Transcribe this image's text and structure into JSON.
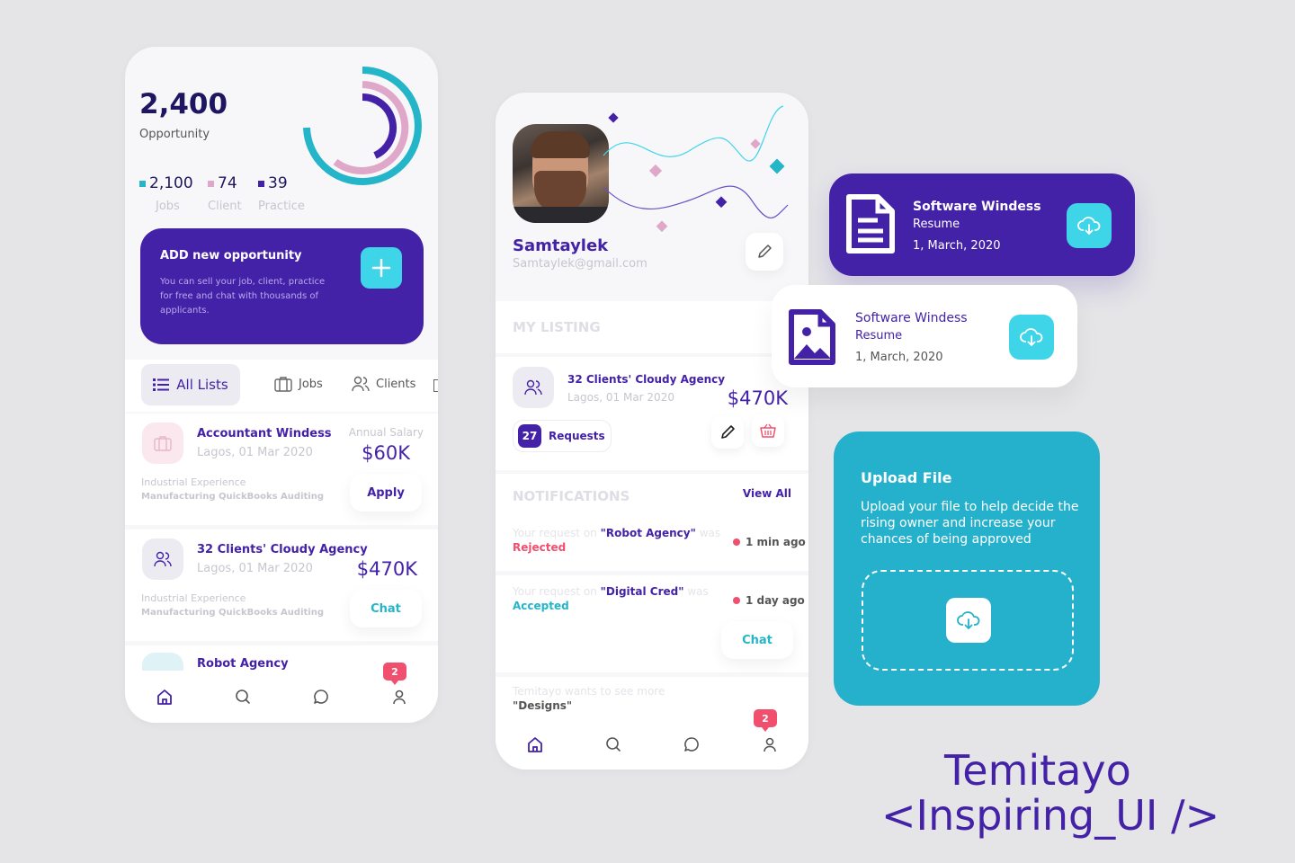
{
  "left_phone": {
    "total_value": "2,400",
    "total_label": "Opportunity",
    "stats": [
      {
        "value": "2,100",
        "label": "Jobs",
        "color": "#25b5c9"
      },
      {
        "value": "74",
        "label": "Client",
        "color": "#e0a8c8"
      },
      {
        "value": "39",
        "label": "Practice",
        "color": "#4422a8"
      }
    ],
    "add_card": {
      "title": "ADD new opportunity",
      "description": "You can sell your job, client, practice for free and chat with thousands of applicants."
    },
    "tabs": [
      "All Lists",
      "Jobs",
      "Clients"
    ],
    "listings": [
      {
        "title": "Accountant Windess",
        "subtitle": "Lagos, 01 Mar 2020",
        "price_label": "Annual Salary",
        "price": "$60K",
        "meta_label": "Industrial Experience",
        "meta_value": "Manufacturing QuickBooks Auditing",
        "action": "Apply"
      },
      {
        "title": "32 Clients' Cloudy Agency",
        "subtitle": "Lagos, 01 Mar 2020",
        "price_label": "",
        "price": "$470K",
        "meta_label": "Industrial Experience",
        "meta_value": "Manufacturing QuickBooks Auditing",
        "action": "Chat"
      },
      {
        "title": "Robot Agency"
      }
    ],
    "nav_badge": "2"
  },
  "middle_phone": {
    "name": "Samtaylek",
    "email": "Samtaylek@gmail.com",
    "listing_header": "MY LISTING",
    "listing": {
      "title": "32 Clients' Cloudy Agency",
      "subtitle": "Lagos, 01 Mar 2020",
      "price": "$470K",
      "requests_count": "27",
      "requests_label": "Requests"
    },
    "notifications_header": "NOTIFICATIONS",
    "view_all": "View All",
    "notifications": [
      {
        "prefix": "Your request on",
        "name": "\"Robot Agency\"",
        "suffix": "was",
        "status": "Rejected",
        "time": "1 min ago"
      },
      {
        "prefix": "Your request on",
        "name": "\"Digital Cred\"",
        "suffix": "was",
        "status": "Accepted",
        "time": "1 day ago",
        "action": "Chat"
      },
      {
        "prefix": "Temitayo wants to see more",
        "name": "\"Designs\""
      }
    ],
    "nav_badge": "2"
  },
  "resume_cards": [
    {
      "title": "Software Windess",
      "type": "Resume",
      "date": "1, March, 2020"
    },
    {
      "title": "Software Windess",
      "type": "Resume",
      "date": "1, March, 2020"
    }
  ],
  "upload": {
    "title": "Upload File",
    "description": "Upload your file to help decide the rising owner and increase your chances of being approved"
  },
  "brand": {
    "line1": "Temitayo",
    "line2": "<Inspiring_UI />"
  },
  "colors": {
    "primary": "#4422a8",
    "accent": "#25b5c9",
    "pink": "#e0a8c8",
    "danger": "#f0506e"
  }
}
